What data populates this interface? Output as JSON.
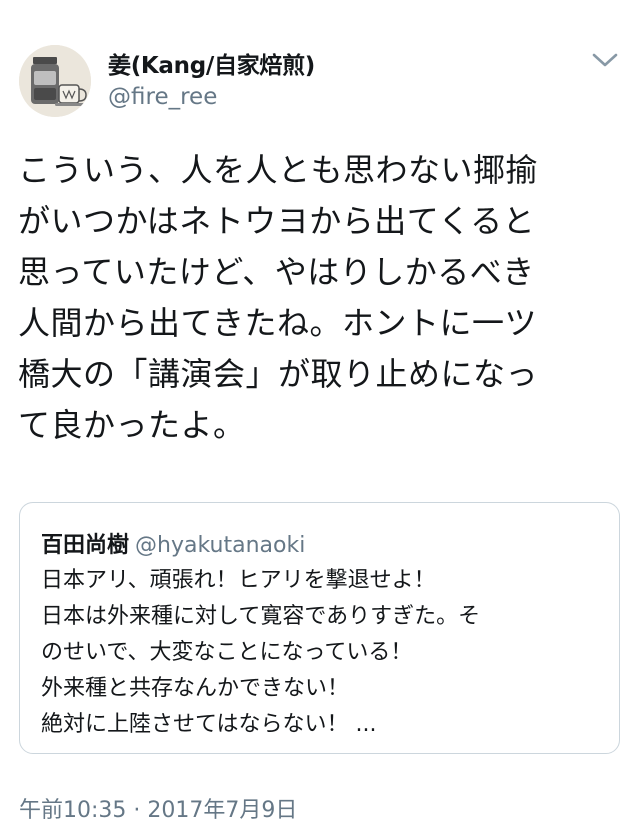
{
  "author": {
    "name": "姜(Kang/自家焙煎)",
    "handle": "@fire_ree",
    "avatar_icon": "coffee-jar-avatar"
  },
  "menu_icon": "chevron-down-icon",
  "tweet": {
    "lines": [
      "こういう、人を人とも思わない揶揄",
      "がいつかはネトウヨから出てくると",
      "思っていたけど、やはりしかるべき",
      "人間から出てきたね。ホントに一ツ",
      "橋大の「講演会」が取り止めになっ",
      "て良かったよ。"
    ]
  },
  "quoted_tweet": {
    "name": "百田尚樹",
    "handle": "@hyakutanaoki",
    "lines": [
      "日本アリ、頑張れ！ヒアリを撃退せよ！",
      "日本は外来種に対して寛容でありすぎた。そ",
      "のせいで、大変なことになっている！",
      "外来種と共存なんかできない！",
      "絶対に上陸させてはならない！ ..."
    ]
  },
  "timestamp": "午前10:35 · 2017年7月9日",
  "colors": {
    "text": "#14171a",
    "secondary": "#657786",
    "border": "#ccd6dd",
    "chevron": "#8899a6"
  }
}
